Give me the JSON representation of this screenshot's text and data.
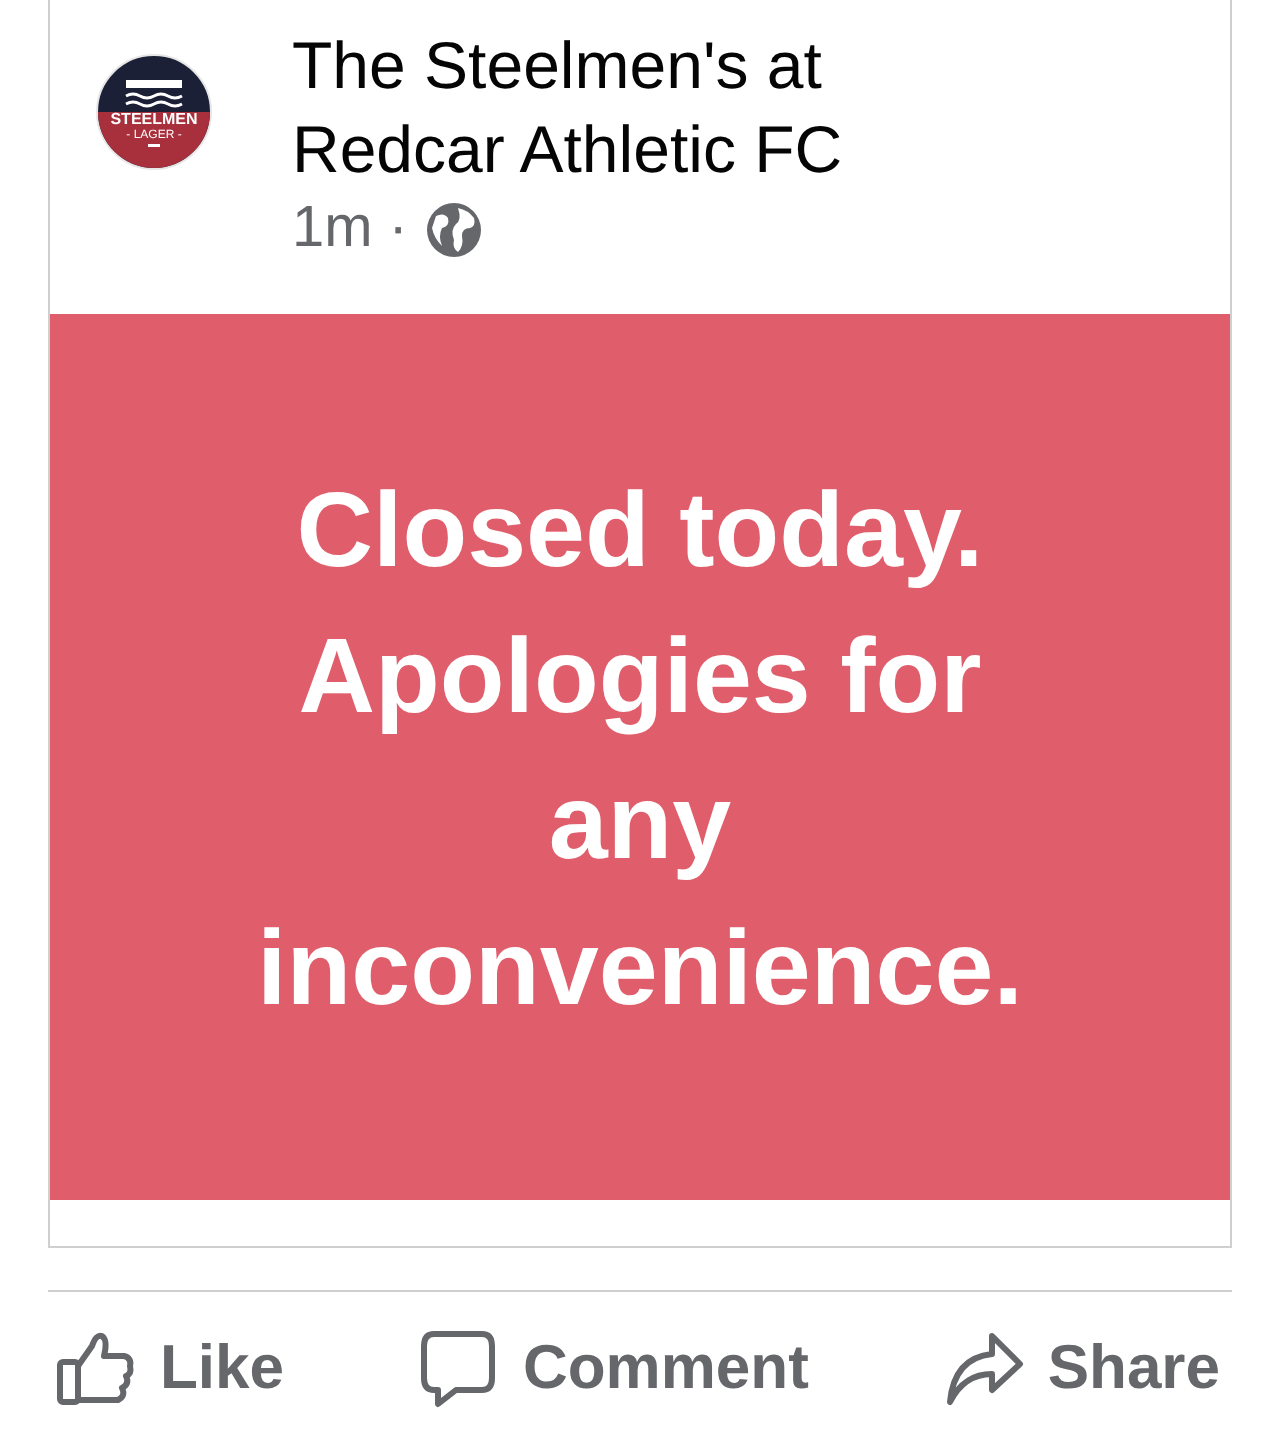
{
  "post": {
    "page_name": "The Steelmen's at Redcar Athletic FC",
    "avatar": {
      "logo_top": "STEELMEN",
      "logo_bottom": "- LAGER -"
    },
    "time": "1m",
    "separator": "·",
    "image_text": "Closed today. Apologies for any inconvenience."
  },
  "actions": [
    {
      "kind": "like",
      "label": "Like"
    },
    {
      "kind": "comment",
      "label": "Comment"
    },
    {
      "kind": "share",
      "label": "Share"
    }
  ]
}
